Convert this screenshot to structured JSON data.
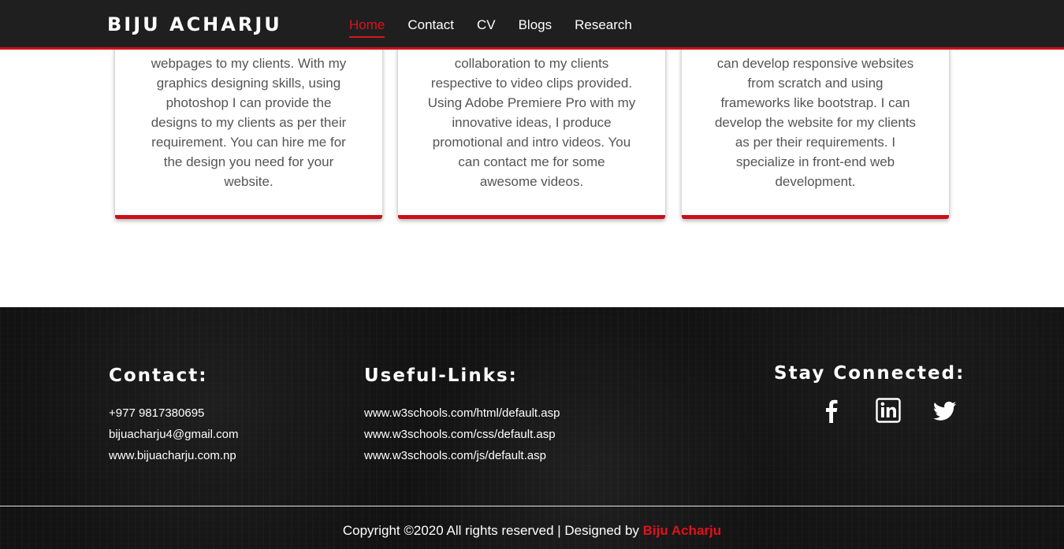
{
  "header": {
    "logo": "BIJU ACHARJU",
    "nav": [
      {
        "label": "Home",
        "active": true
      },
      {
        "label": "Contact",
        "active": false
      },
      {
        "label": "CV",
        "active": false
      },
      {
        "label": "Blogs",
        "active": false
      },
      {
        "label": "Research",
        "active": false
      }
    ]
  },
  "cards": [
    {
      "lines": [
        "webpages to my clients. With my",
        "graphics designing skills, using",
        "photoshop I can provide the",
        "designs to my clients as per their",
        "requirement. You can hire me for",
        "the design you need for your",
        "website."
      ]
    },
    {
      "lines": [
        "collaboration to my clients",
        "respective to video clips provided.",
        "Using Adobe Premiere Pro with my",
        "innovative ideas, I produce",
        "promotional and intro videos. You",
        "can contact me for some",
        "awesome videos."
      ]
    },
    {
      "lines": [
        "can develop responsive websites",
        "from scratch and using",
        "frameworks like bootstrap. I can",
        "develop the website for my clients",
        "as per their requirements. I",
        "specialize in front-end web",
        "development."
      ]
    }
  ],
  "footer": {
    "contact": {
      "heading": "Contact:",
      "phone": "+977 9817380695",
      "email": "bijuacharju4@gmail.com",
      "website": "www.bijuacharju.com.np"
    },
    "links": {
      "heading": "Useful-Links:",
      "items": [
        "www.w3schools.com/html/default.asp",
        "www.w3schools.com/css/default.asp",
        "www.w3schools.com/js/default.asp"
      ]
    },
    "social": {
      "heading": "Stay Connected:",
      "icons": [
        "facebook-icon",
        "linkedin-icon",
        "twitter-icon"
      ]
    },
    "copyright": {
      "text": "Copyright ©2020 All rights reserved | Designed by ",
      "brand": "Biju Acharju"
    }
  },
  "colors": {
    "accent": "#e0111c",
    "header_bg": "#1f1f1f",
    "footer_bg": "#121212"
  }
}
